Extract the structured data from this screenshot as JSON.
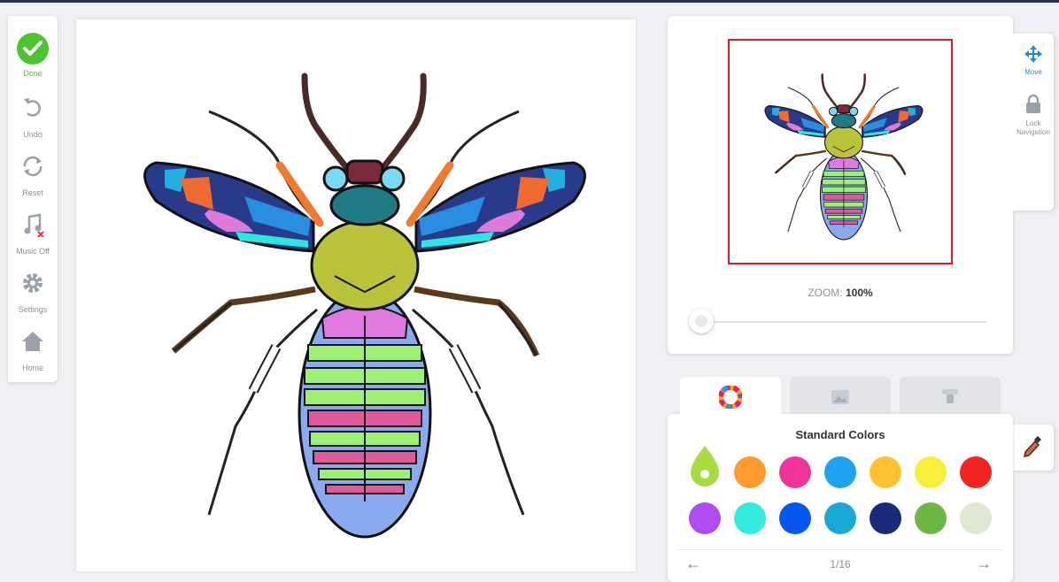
{
  "toolbar": {
    "done": "Done",
    "undo": "Undo",
    "reset": "Reset",
    "music": "Music Off",
    "settings": "Settings",
    "home": "Home"
  },
  "navigator": {
    "zoom_label": "ZOOM:",
    "zoom_value": "100%",
    "zoom_fraction": 0.0,
    "move": "Move",
    "lock_line1": "Lock",
    "lock_line2": "Navigation"
  },
  "palette": {
    "title": "Standard Colors",
    "selected_color": "#a6dc3f",
    "colors": [
      "#ff9a2e",
      "#f0339b",
      "#1fa2ef",
      "#ffc22e",
      "#f8ef3b",
      "#f22320",
      "#b14cf0",
      "#33ece0",
      "#0657f0",
      "#1aa7d8",
      "#1a2a78",
      "#6fb744",
      "#dfe8d0"
    ],
    "page": "1/16"
  },
  "colors": {
    "accent_green": "#4cc431",
    "frame_red": "#e31b23",
    "move_blue": "#1e88e5"
  },
  "icons": [
    "check-icon",
    "undo-icon",
    "reset-icon",
    "music-off-icon",
    "gear-icon",
    "home-icon",
    "move-icon",
    "lock-icon",
    "color-wheel-icon",
    "picture-icon",
    "brush-icon",
    "eyedropper-icon",
    "arrow-left-icon",
    "arrow-right-icon"
  ]
}
